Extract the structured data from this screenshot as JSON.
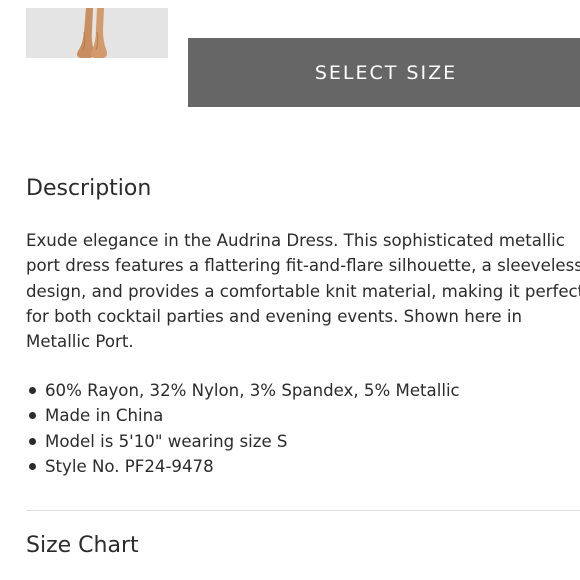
{
  "product": {
    "thumbnail_icon": "product-thumbnail-image"
  },
  "actions": {
    "select_size_label": "SELECT SIZE"
  },
  "description": {
    "heading": "Description",
    "text": "Exude elegance in the Audrina Dress. This sophisticated metallic port dress features a flattering fit-and-flare silhouette, a sleeveless design, and provides a comfortable knit material, making it perfect for both cocktail parties and evening events. Shown here in Metallic Port.",
    "features": [
      "60% Rayon, 32% Nylon, 3% Spandex, 5% Metallic",
      "Made in China",
      "Model is 5'10\" wearing size S",
      "Style No. PF24-9478"
    ]
  },
  "size_chart": {
    "heading": "Size Chart"
  },
  "colors": {
    "button_bg": "#666666",
    "button_text": "#ffffff",
    "text": "#2b2b2b",
    "divider": "#dcdcdc"
  }
}
